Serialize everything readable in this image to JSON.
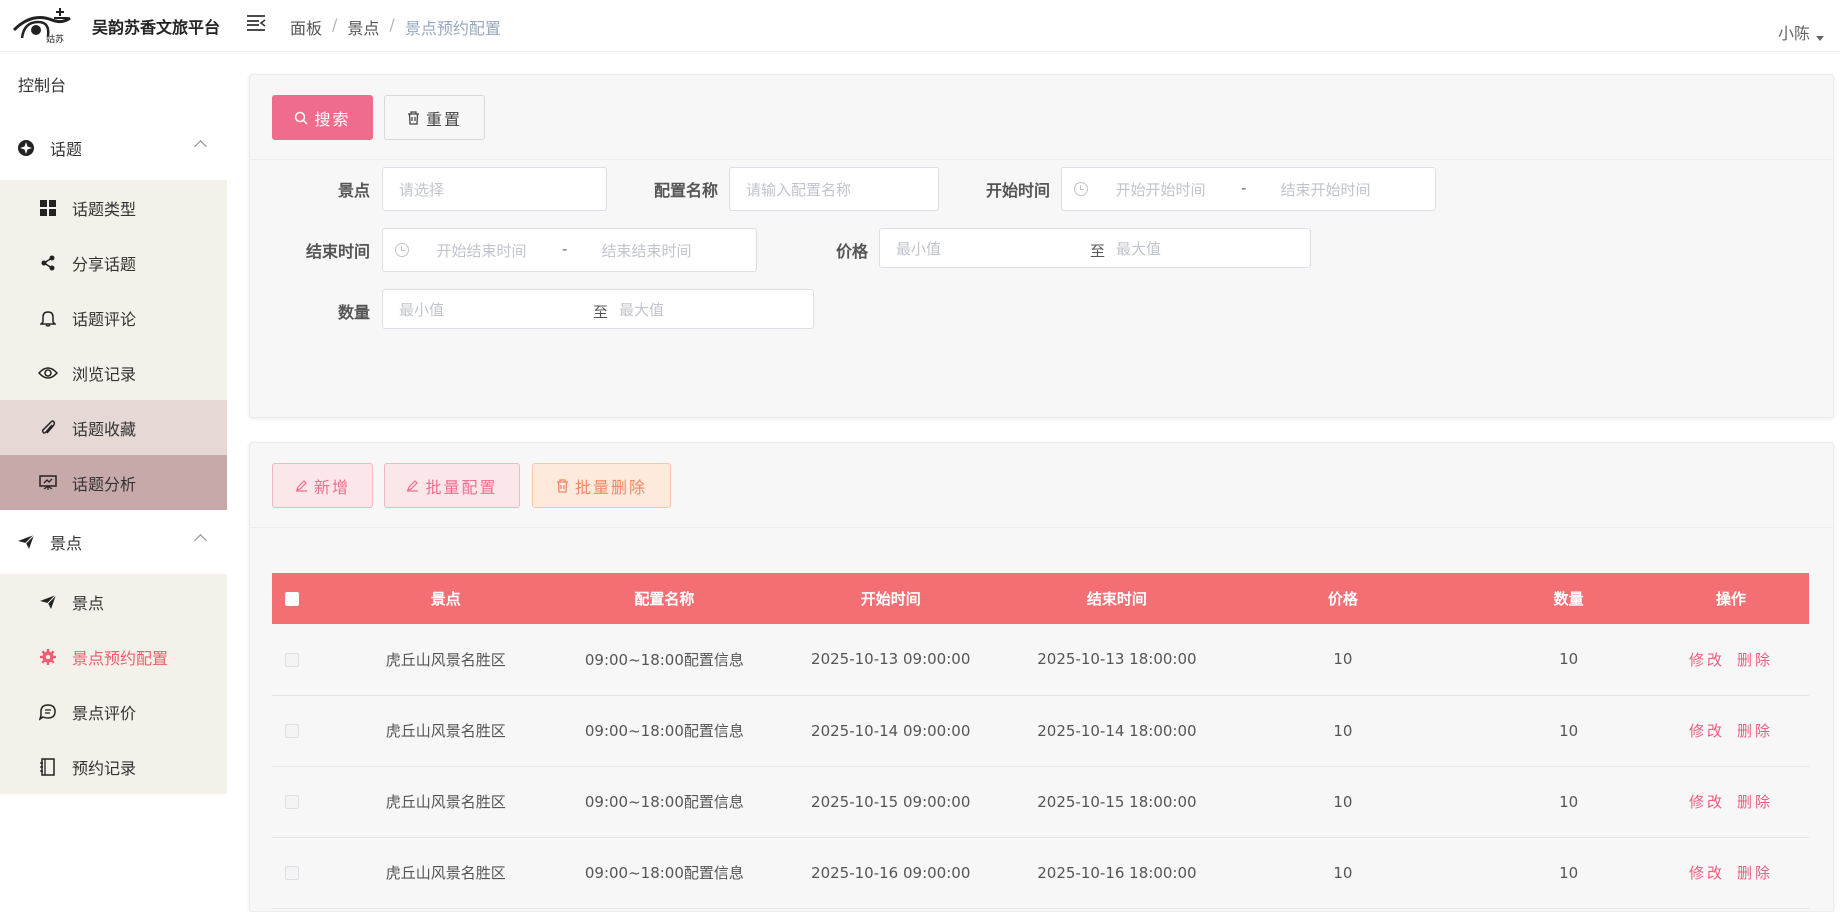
{
  "header": {
    "app_title": "吴韵苏香文旅平台",
    "breadcrumb": [
      "面板",
      "景点",
      "景点预约配置"
    ],
    "user": "小陈"
  },
  "sidebar": {
    "dashboard": "控制台",
    "groups": [
      {
        "label": "话题",
        "icon": "compass-icon",
        "items": [
          {
            "label": "话题类型",
            "icon": "grid-icon"
          },
          {
            "label": "分享话题",
            "icon": "share-icon"
          },
          {
            "label": "话题评论",
            "icon": "bell-icon"
          },
          {
            "label": "浏览记录",
            "icon": "eye-icon"
          },
          {
            "label": "话题收藏",
            "icon": "paperclip-icon"
          },
          {
            "label": "话题分析",
            "icon": "presentation-icon"
          }
        ]
      },
      {
        "label": "景点",
        "icon": "paper-plane-icon",
        "items": [
          {
            "label": "景点",
            "icon": "paper-plane-icon"
          },
          {
            "label": "景点预约配置",
            "icon": "gear-icon"
          },
          {
            "label": "景点评价",
            "icon": "chat-icon"
          },
          {
            "label": "预约记录",
            "icon": "notebook-icon"
          }
        ]
      }
    ]
  },
  "search": {
    "search_button": "搜索",
    "reset_button": "重置",
    "scenic_label": "景点",
    "scenic_placeholder": "请选择",
    "config_name_label": "配置名称",
    "config_name_placeholder": "请输入配置名称",
    "start_time_label": "开始时间",
    "start_time_from": "开始开始时间",
    "start_time_to": "结束开始时间",
    "end_time_label": "结束时间",
    "end_time_from": "开始结束时间",
    "end_time_to": "结束结束时间",
    "price_label": "价格",
    "price_min": "最小值",
    "price_max": "最大值",
    "quantity_label": "数量",
    "quantity_min": "最小值",
    "quantity_max": "最大值",
    "range_to": "至",
    "range_dash": "-"
  },
  "actions": {
    "add": "新增",
    "batch_config": "批量配置",
    "batch_delete": "批量删除"
  },
  "table": {
    "columns": [
      "景点",
      "配置名称",
      "开始时间",
      "结束时间",
      "价格",
      "数量",
      "操作"
    ],
    "edit_label": "修改",
    "delete_label": "删除",
    "rows": [
      {
        "scenic": "虎丘山风景名胜区",
        "name": "09:00~18:00配置信息",
        "start": "2025-10-13 09:00:00",
        "end": "2025-10-13 18:00:00",
        "price": "10",
        "quantity": "10"
      },
      {
        "scenic": "虎丘山风景名胜区",
        "name": "09:00~18:00配置信息",
        "start": "2025-10-14 09:00:00",
        "end": "2025-10-14 18:00:00",
        "price": "10",
        "quantity": "10"
      },
      {
        "scenic": "虎丘山风景名胜区",
        "name": "09:00~18:00配置信息",
        "start": "2025-10-15 09:00:00",
        "end": "2025-10-15 18:00:00",
        "price": "10",
        "quantity": "10"
      },
      {
        "scenic": "虎丘山风景名胜区",
        "name": "09:00~18:00配置信息",
        "start": "2025-10-16 09:00:00",
        "end": "2025-10-16 18:00:00",
        "price": "10",
        "quantity": "10"
      }
    ]
  }
}
